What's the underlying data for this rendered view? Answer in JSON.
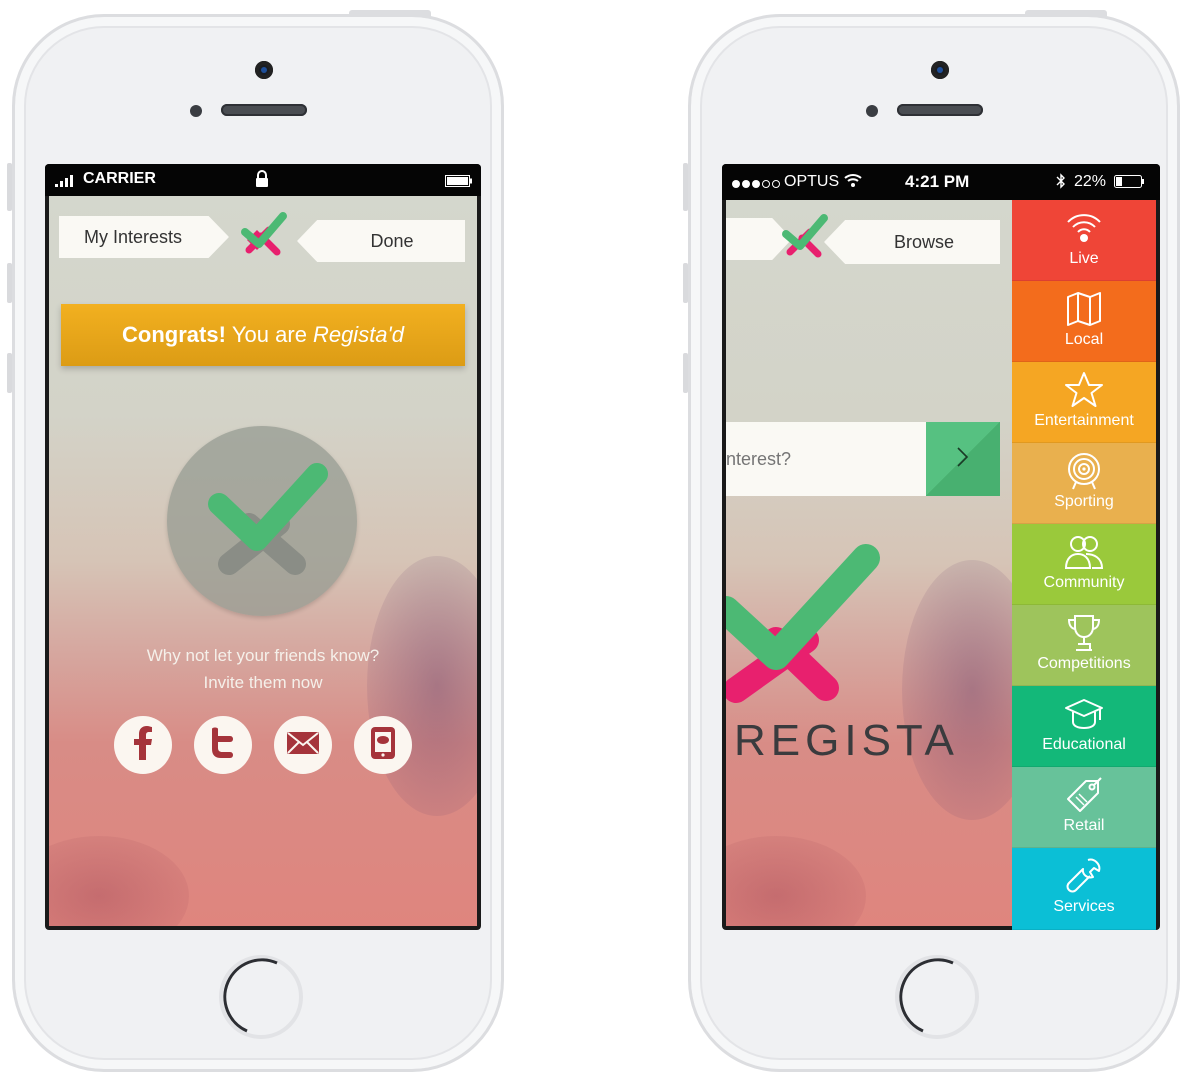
{
  "left_phone": {
    "status": {
      "carrier": "CARRIER"
    },
    "nav": {
      "left_tab": "My Interests",
      "right_tab": "Done"
    },
    "banner": {
      "bold": "Congrats!",
      "mid": "You are",
      "italic": "Regista'd"
    },
    "message": {
      "line1": "Why not let your friends know?",
      "line2": "Invite them now"
    },
    "share": [
      {
        "icon": "facebook-icon"
      },
      {
        "icon": "twitter-icon"
      },
      {
        "icon": "email-icon"
      },
      {
        "icon": "sms-icon"
      }
    ]
  },
  "right_phone": {
    "status": {
      "carrier": "OPTUS",
      "time": "4:21 PM",
      "battery": "22%"
    },
    "nav": {
      "right_tab": "Browse"
    },
    "search": {
      "placeholder": "nterest?"
    },
    "brand": "REGISTA",
    "menu": [
      {
        "label": "Live",
        "icon": "broadcast-icon",
        "color": "#ef4537"
      },
      {
        "label": "Local",
        "icon": "map-icon",
        "color": "#f36c1c"
      },
      {
        "label": "Entertainment",
        "icon": "star-icon",
        "color": "#f5a623"
      },
      {
        "label": "Sporting",
        "icon": "target-icon",
        "color": "#e9b04e"
      },
      {
        "label": "Community",
        "icon": "people-icon",
        "color": "#9ac93b"
      },
      {
        "label": "Competitions",
        "icon": "trophy-icon",
        "color": "#9ec45c"
      },
      {
        "label": "Educational",
        "icon": "graduation-cap-icon",
        "color": "#13b879"
      },
      {
        "label": "Retail",
        "icon": "price-tag-icon",
        "color": "#67c29a"
      },
      {
        "label": "Services",
        "icon": "wrench-icon",
        "color": "#0bbfd6"
      }
    ]
  },
  "colors": {
    "brand_green": "#4cb974",
    "brand_pink": "#e8206e",
    "banner_orange": "#f0a91d"
  }
}
